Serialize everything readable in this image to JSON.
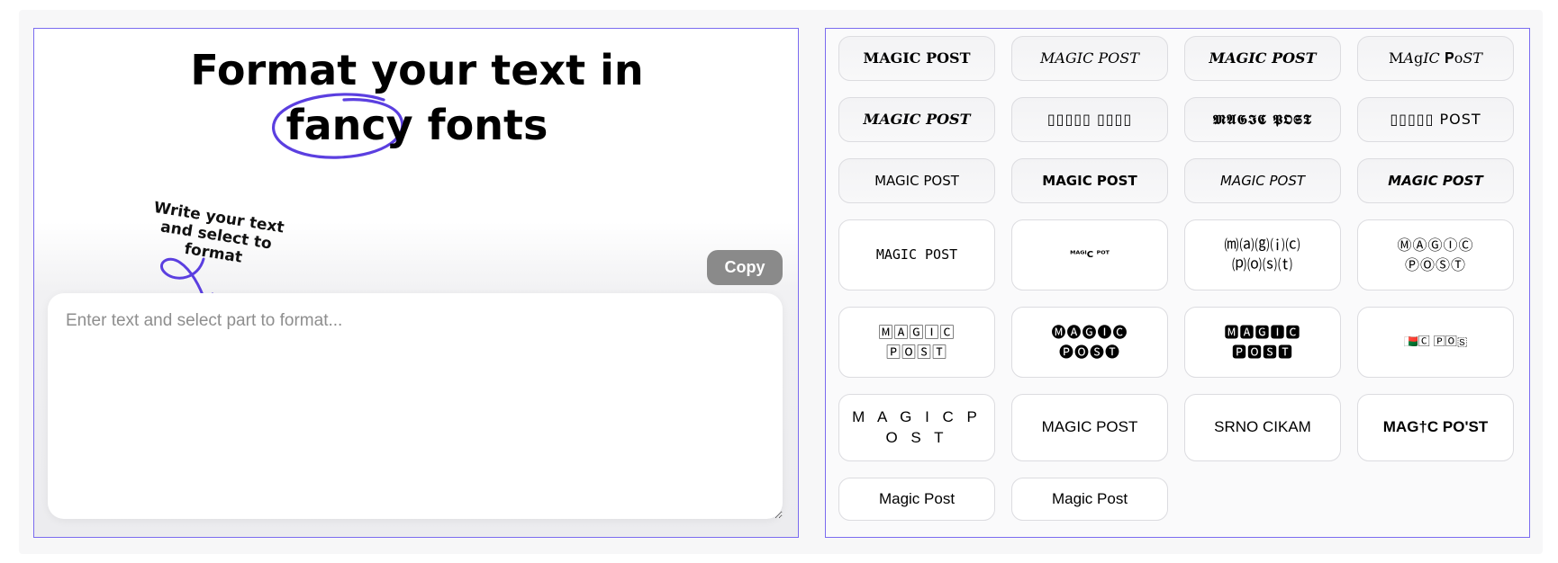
{
  "headline": {
    "line1": "Format your text in",
    "fancy": "fancy",
    "fonts": " fonts"
  },
  "hint": {
    "line1": "Write your text",
    "line2": "and select to format"
  },
  "editor": {
    "placeholder": "Enter text and select part to format...",
    "copy_label": "Copy"
  },
  "colors": {
    "accent": "#5b3fe0",
    "panel_border": "#7b6cf0",
    "copy_button": "#8a8a8a"
  },
  "font_styles": [
    {
      "label": "MAGIC POST"
    },
    {
      "label": "MAGIC POST"
    },
    {
      "label": "MAGIC POST"
    },
    {
      "label": "M𝐴g𝐼𝐶 𝐏o𝑆𝑇"
    },
    {
      "label": "MAGIC POST"
    },
    {
      "label": "▯▯▯▯▯ ▯▯▯▯"
    },
    {
      "label": "𝕸𝕬𝕲𝕴𝕮 𝕻𝕺𝕾𝕿"
    },
    {
      "label": "▯▯▯▯▯ POST"
    },
    {
      "label": "MAGIC POST"
    },
    {
      "label": "MAGIC POST"
    },
    {
      "label": "MAGIC POST"
    },
    {
      "label": "MAGIC POST"
    },
    {
      "label": "MAGIC POST"
    },
    {
      "label": "ᴹᴬᴳᴵC ᴾᴼᵀ"
    },
    {
      "label": "⒨⒜⒢⒤⒞ ⒫⒪⒮⒯"
    },
    {
      "label": "ⓂⒶⒼⒾⒸ ⓅⓄⓈⓉ"
    },
    {
      "label": "🄼🄰🄶🄸🄲 🄿🄾🅂🅃"
    },
    {
      "label": "🅜🅐🅖🅘🅒 🅟🅞🅢🅣"
    },
    {
      "label": "🅼🅰🅶🅸🅲 🅿🅾🆂🆃"
    },
    {
      "label": "🇲🇬🄲 🄿🄾🇸"
    },
    {
      "label": "M A G I C P O S T"
    },
    {
      "label": "MAGIC POST"
    },
    {
      "label": "SRNO CIKAM"
    },
    {
      "label": "MAG†C PO'ST"
    },
    {
      "label": "Magic Post"
    },
    {
      "label": "Magic Post"
    }
  ]
}
